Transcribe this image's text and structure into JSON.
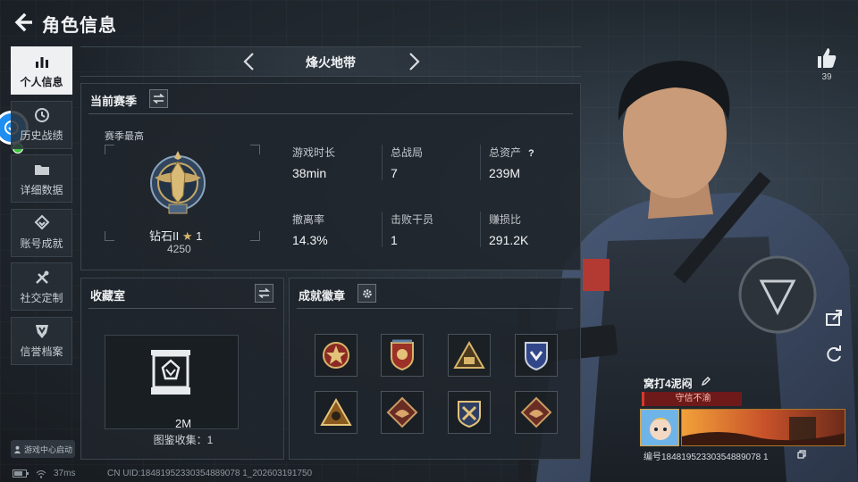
{
  "header": {
    "title": "角色信息"
  },
  "sidebar": {
    "items": [
      {
        "label": "个人信息",
        "icon": "bar-chart-icon",
        "active": true
      },
      {
        "label": "历史战绩",
        "icon": "clock-icon",
        "active": false
      },
      {
        "label": "详细数据",
        "icon": "folder-icon",
        "active": false
      },
      {
        "label": "账号成就",
        "icon": "achievement-icon",
        "active": false
      },
      {
        "label": "社交定制",
        "icon": "tools-icon",
        "active": false
      },
      {
        "label": "信誉档案",
        "icon": "shield-icon",
        "active": false
      }
    ],
    "launcher_label": "游戏中心启动"
  },
  "map": {
    "name": "烽火地带"
  },
  "season": {
    "title": "当前赛季",
    "subtitle": "赛季最高",
    "rank_name": "钻石II",
    "rank_stars": "1",
    "rank_score": "4250",
    "stats": [
      {
        "label": "游戏时长",
        "value": "38min"
      },
      {
        "label": "总战局",
        "value": "7"
      },
      {
        "label": "总资产",
        "value": "239M",
        "help": "?"
      },
      {
        "label": "撤离率",
        "value": "14.3%"
      },
      {
        "label": "击败干员",
        "value": "1"
      },
      {
        "label": "赚损比",
        "value": "291.2K"
      }
    ]
  },
  "collection": {
    "title": "收藏室",
    "value": "2M",
    "count_text": "图鉴收集：1"
  },
  "achievements": {
    "title": "成就徽章",
    "badges": [
      "star-emblem-icon",
      "eagle-shield-icon",
      "triangle-emblem-icon",
      "blue-shield-icon",
      "triangle-gold-icon",
      "hawk-diamond-icon",
      "crossed-swords-icon",
      "hawk-diamond-icon"
    ]
  },
  "profile": {
    "likes": "39",
    "player_name": "窝打4泥闷",
    "reputation": "守信不渝",
    "uid_text": "编号18481952330354889078 1",
    "colors": {
      "reputation_bg": "#6e1a1a",
      "accent": "#d9a64a"
    }
  },
  "status": {
    "ping": "37ms",
    "cn_uid": "CN UID:18481952330354889078 1_202603191750"
  }
}
